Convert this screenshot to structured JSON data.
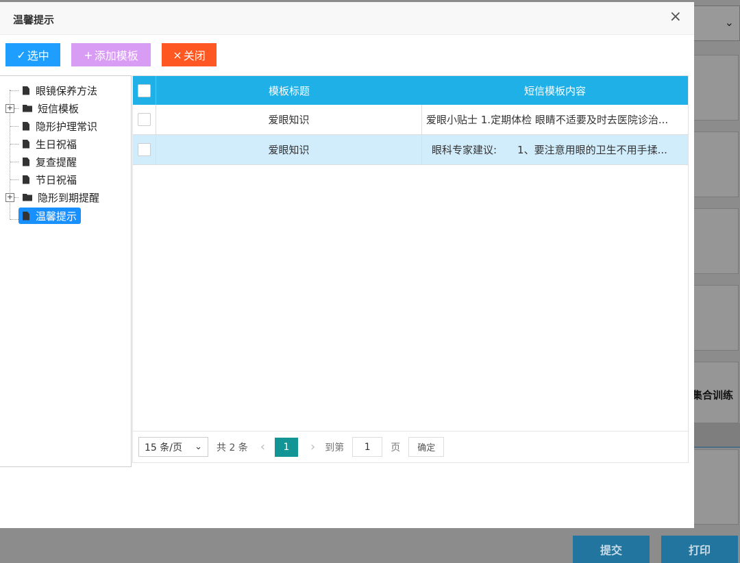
{
  "background": {
    "section_label": "集合训练",
    "submit_label": "提交",
    "print_label": "打印"
  },
  "dialog": {
    "title": "温馨提示",
    "close_glyph": "×"
  },
  "toolbar": {
    "select_label": "选中",
    "add_label": "添加模板",
    "close_label": "关闭"
  },
  "tree": {
    "items": [
      {
        "label": "眼镜保养方法",
        "type": "file"
      },
      {
        "label": "短信模板",
        "type": "folder"
      },
      {
        "label": "隐形护理常识",
        "type": "file"
      },
      {
        "label": "生日祝福",
        "type": "file"
      },
      {
        "label": "复查提醒",
        "type": "file"
      },
      {
        "label": "节日祝福",
        "type": "file"
      },
      {
        "label": "隐形到期提醒",
        "type": "folder"
      },
      {
        "label": "温馨提示",
        "type": "file",
        "active": true
      }
    ]
  },
  "table": {
    "headers": {
      "title": "模板标题",
      "content": "短信模板内容"
    },
    "rows": [
      {
        "title": "爱眼知识",
        "content": "爱眼小贴士 1.定期体检 眼睛不适要及时去医院诊治...",
        "selected": false
      },
      {
        "title": "爱眼知识",
        "content": "眼科专家建议:　　1、要注意用眼的卫生不用手揉...",
        "selected": true
      }
    ]
  },
  "pager": {
    "page_size": "15 条/页",
    "total": "共 2 条",
    "current_page": "1",
    "goto_label": "到第",
    "goto_value": "1",
    "page_unit": "页",
    "confirm_label": "确定"
  },
  "colors": {
    "header_blue": "#1fb0e8",
    "select_btn": "#1e9fff",
    "add_btn": "#d99cf5",
    "close_btn": "#ff5722",
    "page_active": "#139595"
  }
}
